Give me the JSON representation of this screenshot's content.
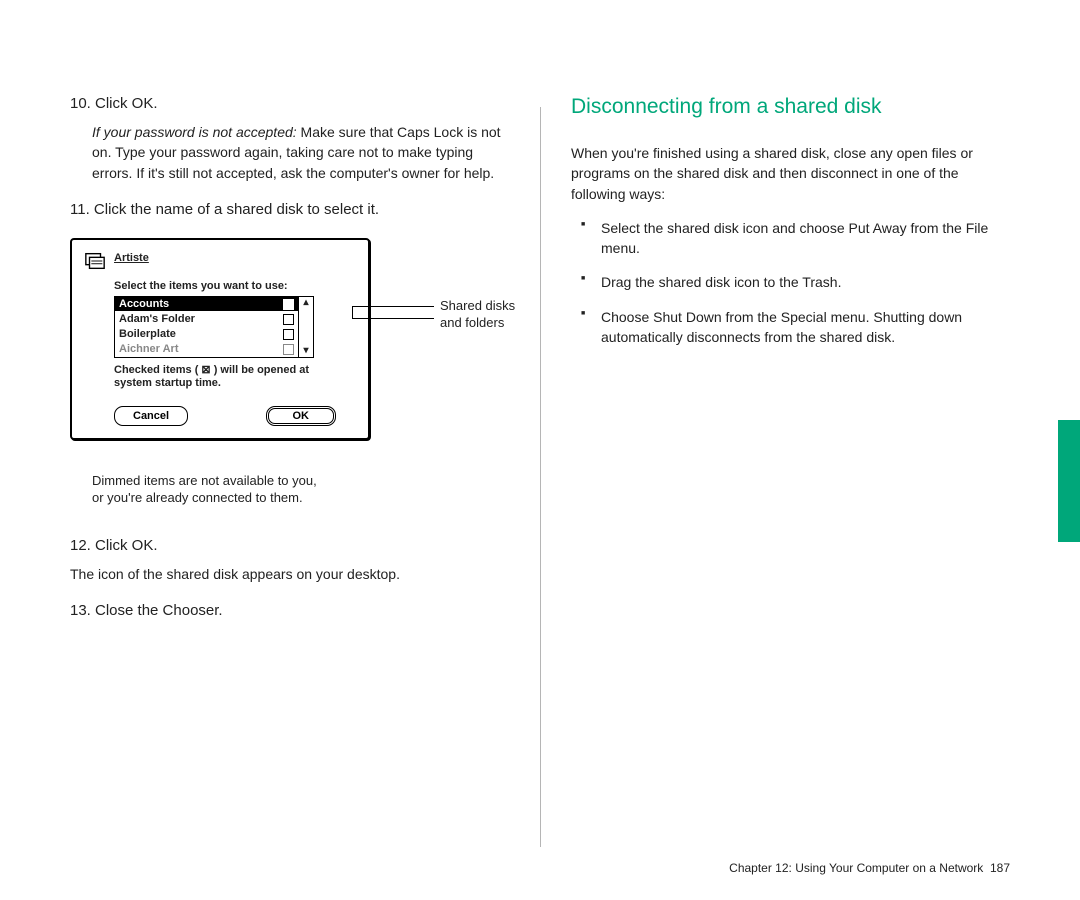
{
  "left": {
    "step10": "10. Click OK.",
    "step10_body_em": "If your password is not accepted:",
    "step10_body": "  Make sure that Caps Lock is not on. Type your password again, taking care not to make typing errors. If it's still not accepted, ask the computer's owner for help.",
    "step11": "11. Click the name of a shared disk to select it.",
    "dialog": {
      "title": "Artiste",
      "prompt": "Select the items you want to use:",
      "items": [
        {
          "label": "Accounts",
          "selected": true,
          "dimmed": false
        },
        {
          "label": "Adam's Folder",
          "selected": false,
          "dimmed": false
        },
        {
          "label": "Boilerplate",
          "selected": false,
          "dimmed": false
        },
        {
          "label": "Aichner Art",
          "selected": false,
          "dimmed": true
        }
      ],
      "note": "Checked items ( ⊠ ) will be opened at\nsystem startup time.",
      "cancel": "Cancel",
      "ok": "OK"
    },
    "callout1": "Shared disks\nand folders",
    "caption": "Dimmed items are not available to you,\nor you're already connected to them.",
    "step12": "12. Click OK.",
    "step12_body": "The icon of the shared disk appears on your desktop.",
    "step13": "13. Close the Chooser."
  },
  "right": {
    "heading": "Disconnecting from a shared disk",
    "intro": "When you're finished using a shared disk, close any open files or programs on the shared disk and then disconnect in one of the following ways:",
    "bullets": [
      "Select the shared disk icon and choose Put Away from the File menu.",
      "Drag the shared disk icon to the Trash.",
      "Choose Shut Down from the Special menu. Shutting down automatically disconnects from the shared disk."
    ]
  },
  "footer": {
    "chapter": "Chapter 12: Using Your Computer on a Network",
    "page": "187"
  }
}
